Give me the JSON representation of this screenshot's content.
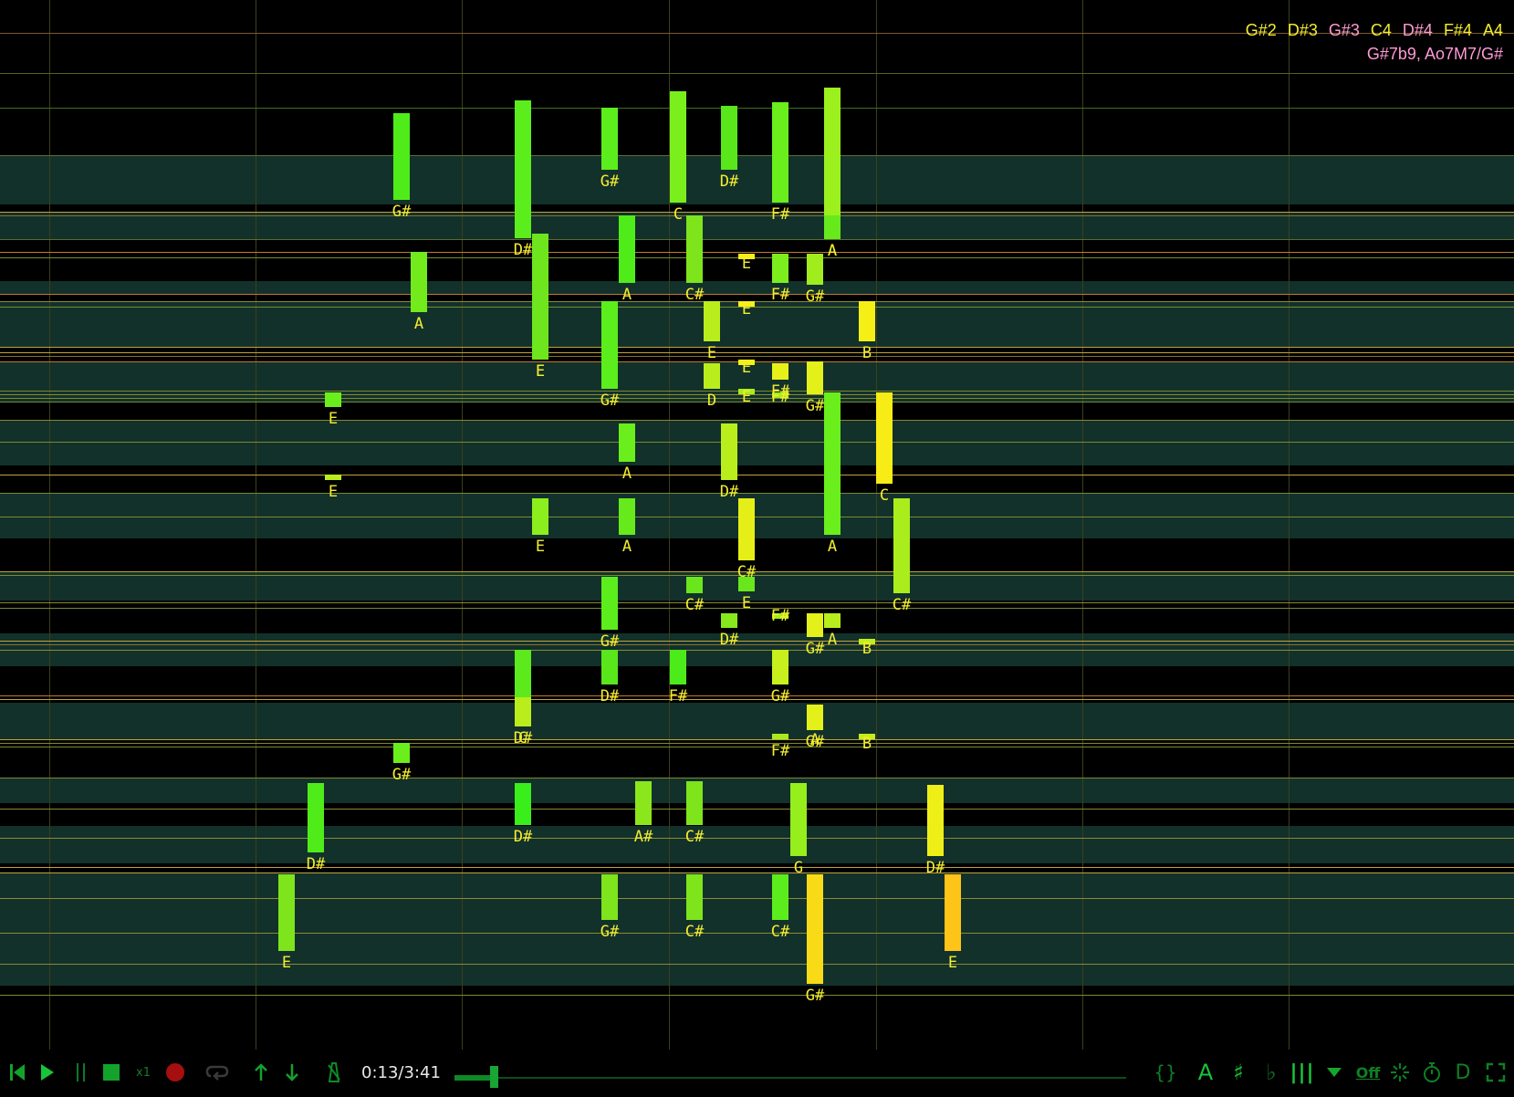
{
  "colors": {
    "background": "#000000",
    "band": "#12312b",
    "label": "#f3ee2e",
    "chord_highlight": "#ff9ad5",
    "chord_plain": "#f3ee2e",
    "toolbar_icon": "#16a52e"
  },
  "chord_info": {
    "notes": [
      {
        "text": "G#2",
        "highlight": false
      },
      {
        "text": "D#3",
        "highlight": false
      },
      {
        "text": "G#3",
        "highlight": true
      },
      {
        "text": "C4",
        "highlight": false
      },
      {
        "text": "D#4",
        "highlight": true
      },
      {
        "text": "F#4",
        "highlight": false
      },
      {
        "text": "A4",
        "highlight": false
      }
    ],
    "names": "G#7b9, Ao7M7/G#"
  },
  "notes": [
    {
      "name": "G#",
      "color": "#4fec1a"
    },
    {
      "name": "D#",
      "color": "#5cee1c"
    },
    {
      "name": "G#",
      "color": "#5cee1c"
    },
    {
      "name": "C",
      "color": "#7bef1c"
    },
    {
      "name": "D#",
      "color": "#59e61b"
    },
    {
      "name": "F#",
      "color": "#6aee1c"
    },
    {
      "name": "A",
      "color": "#9cf01e"
    },
    {
      "name": "A",
      "color": "#66ea1c"
    },
    {
      "name": "E",
      "color": "#6ee51c"
    },
    {
      "name": "A",
      "color": "#50ec1a"
    },
    {
      "name": "C#",
      "color": "#7ee41c"
    },
    {
      "name": "E",
      "color": "#f8ef16"
    },
    {
      "name": "F#",
      "color": "#7cee1e"
    },
    {
      "name": "G#",
      "color": "#a0ec1c"
    },
    {
      "name": "E",
      "color": "#6ee51c"
    },
    {
      "name": "G#",
      "color": "#5cee1c"
    },
    {
      "name": "E",
      "color": "#f8ef16"
    },
    {
      "name": "B",
      "color": "#f6ef16"
    },
    {
      "name": "E",
      "color": "#b9ee1c"
    },
    {
      "name": "D",
      "color": "#b9ee1c"
    },
    {
      "name": "E",
      "color": "#f8ef16"
    },
    {
      "name": "F#",
      "color": "#e8f019"
    },
    {
      "name": "G#",
      "color": "#e4f019"
    },
    {
      "name": "E",
      "color": "#a8ec1c"
    },
    {
      "name": "F#",
      "color": "#a6ec1c"
    },
    {
      "name": "A",
      "color": "#72ea1c"
    },
    {
      "name": "D#",
      "color": "#b9ee1c"
    },
    {
      "name": "A",
      "color": "#6aee1c"
    },
    {
      "name": "C",
      "color": "#f8ec17"
    },
    {
      "name": "E",
      "color": "#6aee1c"
    },
    {
      "name": "E",
      "color": "#b9ee1c"
    },
    {
      "name": "A",
      "color": "#6aee1c"
    },
    {
      "name": "E",
      "color": "#8cee1c"
    },
    {
      "name": "A",
      "color": "#66ea1c"
    },
    {
      "name": "C#",
      "color": "#e6ee18"
    },
    {
      "name": "E",
      "color": "#6ae61c"
    },
    {
      "name": "C#",
      "color": "#6ae61c"
    },
    {
      "name": "F#",
      "color": "#a6ec1c"
    },
    {
      "name": "G#",
      "color": "#e4f019"
    },
    {
      "name": "A",
      "color": "#b7ee1c"
    },
    {
      "name": "B",
      "color": "#c2ee1a"
    },
    {
      "name": "D#",
      "color": "#86ea1c"
    },
    {
      "name": "C#",
      "color": "#a9ee1c"
    },
    {
      "name": "G#",
      "color": "#5cee1c"
    },
    {
      "name": "D#",
      "color": "#59e61b"
    },
    {
      "name": "C",
      "color": "#5cea1c"
    },
    {
      "name": "F#",
      "color": "#4cec1a"
    },
    {
      "name": "G#",
      "color": "#c8f01c"
    },
    {
      "name": "D#",
      "color": "#b9ee1c"
    },
    {
      "name": "A",
      "color": "#b9ee1c"
    },
    {
      "name": "B",
      "color": "#c2ee1a"
    },
    {
      "name": "F#",
      "color": "#a6ec1c"
    },
    {
      "name": "G#",
      "color": "#e4f019"
    },
    {
      "name": "G#",
      "color": "#6aee1c"
    },
    {
      "name": "D#",
      "color": "#50ec1a"
    },
    {
      "name": "D#",
      "color": "#3aee1c"
    },
    {
      "name": "A#",
      "color": "#8ce61c"
    },
    {
      "name": "C#",
      "color": "#7ee41c"
    },
    {
      "name": "G",
      "color": "#96ee1c"
    },
    {
      "name": "D#",
      "color": "#eeef17"
    },
    {
      "name": "C#",
      "color": "#7ee41c"
    },
    {
      "name": "G#",
      "color": "#7ee41c"
    },
    {
      "name": "C#",
      "color": "#5cee1c"
    },
    {
      "name": "E",
      "color": "#7ee41c"
    },
    {
      "name": "G#",
      "color": "#f8db16"
    },
    {
      "name": "E",
      "color": "#ffc418"
    }
  ],
  "toolbar": {
    "time": "0:13/3:41",
    "speed": "x1",
    "accidental_label": "A",
    "sharp": "♯",
    "flat": "♭",
    "bars": "|||",
    "off_label": "Off",
    "d_label": "D",
    "brace": "{}",
    "progress": 0.059
  }
}
